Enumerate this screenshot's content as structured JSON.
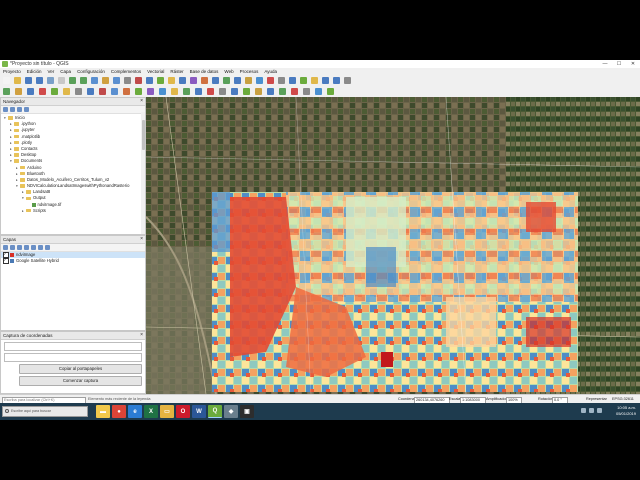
{
  "window": {
    "title": "*Proyecto sin título - QGIS",
    "minimize": "—",
    "maximize": "☐",
    "close": "✕"
  },
  "menu": [
    "Proyecto",
    "Edición",
    "Ver",
    "Capa",
    "Configuración",
    "Complementos",
    "Vectorial",
    "Ráster",
    "Base de datos",
    "Web",
    "Procesos",
    "Ayuda"
  ],
  "navigator": {
    "title": "Navegador",
    "items": [
      {
        "label": "Inicio",
        "type": "folder",
        "level": 0,
        "open": true
      },
      {
        "label": ".ipython",
        "type": "folder",
        "level": 1
      },
      {
        "label": ".jupyter",
        "type": "folder",
        "level": 1
      },
      {
        "label": ".matplotlib",
        "type": "folder",
        "level": 1
      },
      {
        "label": ".plotly",
        "type": "folder",
        "level": 1
      },
      {
        "label": "Contacts",
        "type": "folder",
        "level": 1
      },
      {
        "label": "Desktop",
        "type": "folder",
        "level": 1
      },
      {
        "label": "Documents",
        "type": "folder",
        "level": 1,
        "open": true
      },
      {
        "label": "Arduino",
        "type": "folder",
        "level": 2
      },
      {
        "label": "Bluetooth",
        "type": "folder",
        "level": 2
      },
      {
        "label": "Datos_Modelo_Acuifero_Cerritos_Tulum_v2",
        "type": "folder",
        "level": 2
      },
      {
        "label": "NDVICalculationLandsatImageswithPythonandRasterio",
        "type": "folder",
        "level": 2,
        "open": true
      },
      {
        "label": "Landsat8",
        "type": "folder",
        "level": 3
      },
      {
        "label": "Output",
        "type": "folder",
        "level": 3,
        "open": true
      },
      {
        "label": "ndviImage.tif",
        "type": "file",
        "level": 4
      },
      {
        "label": "Scripts",
        "type": "folder",
        "level": 3
      }
    ]
  },
  "layers": {
    "title": "Capas",
    "items": [
      {
        "label": "ndviImage",
        "selected": true,
        "color": "#d73027"
      },
      {
        "label": "Google Satellite Hybrid",
        "selected": false,
        "color": "#4a7ab5"
      }
    ]
  },
  "coords": {
    "title": "Captura de coordenadas",
    "copy_button": "Copiar al portapapeles",
    "start_button": "Comenzar captura"
  },
  "status": {
    "locator_placeholder": "Escriba para localizar (Ctrl+K)",
    "message": "Elemento más reciente de la leyenda",
    "coord_label": "Coordenada",
    "coord_value": "260134,4076260",
    "scale_label": "Escala",
    "scale_value": "1:1083000",
    "magnifier_label": "Amplificador",
    "magnifier_value": "100%",
    "rotation_label": "Rotación",
    "rotation_value": "0.0 °",
    "render_label": "Representar",
    "epsg": "EPSG:32611"
  },
  "taskbar": {
    "search_placeholder": "Escribe aquí para buscar",
    "time": "10:05 a.m.",
    "date": "05/01/2019",
    "apps": [
      {
        "name": "file-explorer",
        "color": "#f2c94c",
        "glyph": "▬"
      },
      {
        "name": "chrome",
        "color": "#db4437",
        "glyph": "●"
      },
      {
        "name": "edge",
        "color": "#2b7cd3",
        "glyph": "e"
      },
      {
        "name": "excel",
        "color": "#1f7244",
        "glyph": "X"
      },
      {
        "name": "folder",
        "color": "#e3b341",
        "glyph": "▭"
      },
      {
        "name": "opera",
        "color": "#cc1b2b",
        "glyph": "O"
      },
      {
        "name": "word",
        "color": "#2b5797",
        "glyph": "W"
      },
      {
        "name": "qgis",
        "color": "#6bab3c",
        "glyph": "Q"
      },
      {
        "name": "shield",
        "color": "#6a7f8d",
        "glyph": "◆"
      },
      {
        "name": "terminal",
        "color": "#2d2d2d",
        "glyph": "▣"
      }
    ]
  }
}
